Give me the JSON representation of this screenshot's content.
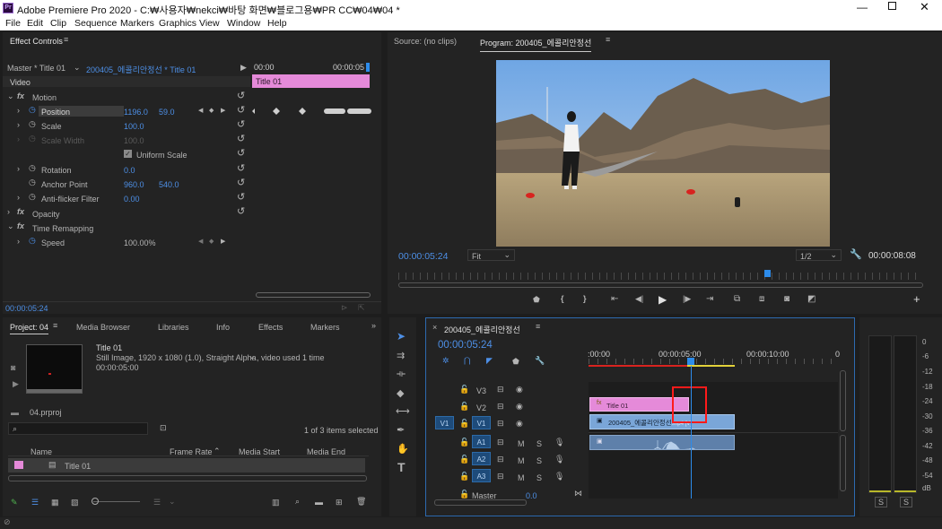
{
  "window": {
    "title": "Adobe Premiere Pro 2020 - C:₩사용자₩nekci₩바탕 화면₩블로그용₩PR CC₩04₩04 *"
  },
  "menu": [
    "File",
    "Edit",
    "Clip",
    "Sequence",
    "Markers",
    "Graphics",
    "View",
    "Window",
    "Help"
  ],
  "effect_controls": {
    "tab": "Effect Controls",
    "master": "Master * Title 01",
    "clip": "200405_에콜리안정선 * Title 01",
    "ruler_start": "00:00",
    "ruler_end": "00:00:05",
    "clip_bar": "Title 01",
    "video_label": "Video",
    "motion": "Motion",
    "position": "Position",
    "position_x": "1196.0",
    "position_y": "59.0",
    "scale": "Scale",
    "scale_val": "100.0",
    "scale_width": "Scale Width",
    "scale_width_val": "100.0",
    "uniform_scale": "Uniform Scale",
    "rotation": "Rotation",
    "rotation_val": "0.0",
    "anchor": "Anchor Point",
    "anchor_x": "960.0",
    "anchor_y": "540.0",
    "antiflicker": "Anti-flicker Filter",
    "antiflicker_val": "0.00",
    "opacity": "Opacity",
    "time_remap": "Time Remapping",
    "speed": "Speed",
    "speed_val": "100.00%",
    "timecode": "00:00:05:24"
  },
  "monitor": {
    "source_tab": "Source: (no clips)",
    "program_tab": "Program: 200405_에콜리안정선",
    "timecode": "00:00:05:24",
    "fit": "Fit",
    "res": "1/2",
    "duration": "00:00:08:08"
  },
  "project": {
    "tabs": [
      "Project: 04",
      "Media Browser",
      "Libraries",
      "Info",
      "Effects",
      "Markers"
    ],
    "item_name": "Title 01",
    "item_info": "Still Image, 1920 x 1080 (1.0), Straight Alpha",
    "item_used": ", video used 1 time",
    "item_dur": "00:00:05:00",
    "file": "04.prproj",
    "count": "1 of 3 items selected",
    "col_name": "Name",
    "col_fps": "Frame Rate",
    "col_start": "Media Start",
    "col_end": "Media End",
    "row_name": "Title 01"
  },
  "timeline": {
    "tab": "200405_에콜리안정선",
    "timecode": "00:00:05:24",
    "ruler": [
      ":00:00",
      "00:00:05:00",
      "00:00:10:00"
    ],
    "tracks_v": [
      "V3",
      "V2",
      "V1"
    ],
    "tracks_a": [
      "A1",
      "A2",
      "A3"
    ],
    "master": "Master",
    "master_val": "0.0",
    "src_v1": "V1",
    "clip_title": "Title 01",
    "clip_video": "200405_에콜리안정선",
    "clip_video_suffix": ".mp4 [V]",
    "m": "M",
    "s": "S"
  },
  "meter": {
    "scale": [
      "0",
      "-6",
      "-12",
      "-18",
      "-24",
      "-30",
      "-36",
      "-42",
      "-48",
      "-54",
      "dB"
    ],
    "s": "S"
  },
  "colors": {
    "accent": "#2d8ceb",
    "title_clip": "#e58ad9",
    "video_clip": "#7aa6d8",
    "highlight": "#ff1a1a"
  }
}
